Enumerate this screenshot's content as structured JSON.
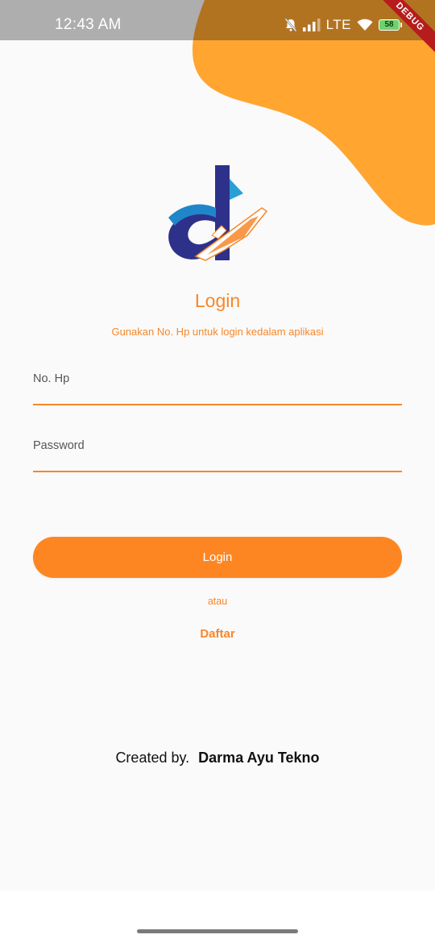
{
  "status_bar": {
    "time": "12:43 AM",
    "network": "LTE",
    "battery": "58",
    "debug_label": "DEBUG"
  },
  "colors": {
    "accent": "#f7872a",
    "button": "#fd8623",
    "blob": "#ffa530"
  },
  "login": {
    "title": "Login",
    "subtitle": "Gunakan No. Hp untuk login kedalam aplikasi",
    "phone_label": "No. Hp",
    "password_label": "Password",
    "login_button": "Login",
    "or_text": "atau",
    "register_link": "Daftar"
  },
  "footer": {
    "created_by": "Created by.",
    "company": "Darma Ayu Tekno"
  },
  "icons": [
    "app-logo",
    "mute-icon",
    "signal-icon",
    "wifi-icon",
    "battery-icon"
  ]
}
